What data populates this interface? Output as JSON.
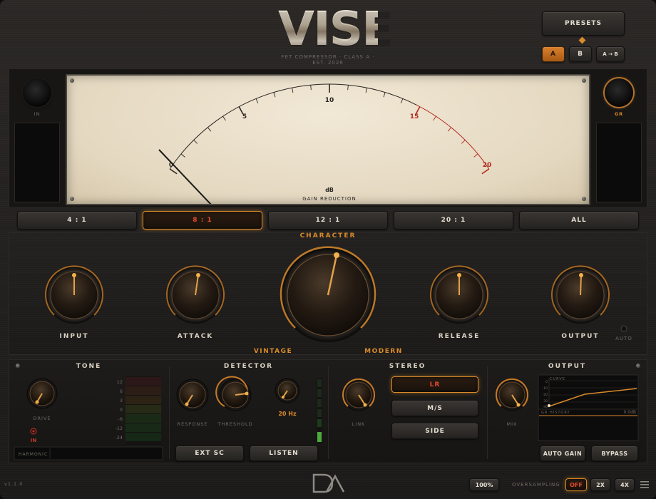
{
  "header": {
    "logo": "VISE",
    "subtitle": "FET COMPRESSOR  ·  CLASS A  ·  EST. 2026",
    "presets_label": "PRESETS",
    "ab_a": "A",
    "ab_b": "B",
    "ab_copy": "A → B"
  },
  "meter": {
    "in_label": "IN",
    "gr_label": "GR",
    "scale_labels": [
      "0",
      "5",
      "10",
      "15",
      "20"
    ],
    "unit": "dB",
    "caption": "GAIN REDUCTION",
    "needle_value_db": 0
  },
  "ratios": [
    "4 : 1",
    "8 : 1",
    "12 : 1",
    "20 : 1",
    "ALL"
  ],
  "ratio_selected": "8 : 1",
  "knobs": {
    "character_label": "CHARACTER",
    "input": "INPUT",
    "attack": "ATTACK",
    "release": "RELEASE",
    "output": "OUTPUT",
    "vintage": "VINTAGE",
    "modern": "MODERN",
    "auto": "AUTO"
  },
  "tone": {
    "title": "TONE",
    "drive_label": "DRIVE",
    "in_label": "IN",
    "harmonic_label": "HARMONIC",
    "scale": [
      "12",
      "6",
      "3",
      "0",
      "-6",
      "-12",
      "-24"
    ]
  },
  "detector": {
    "title": "DETECTOR",
    "response_label": "RESPONSE",
    "threshold_label": "THRESHOLD",
    "hpf_value": "20 Hz",
    "ext_sc": "EXT SC",
    "listen": "LISTEN"
  },
  "stereo": {
    "title": "STEREO",
    "link_label": "LINK",
    "modes": [
      "LR",
      "M/S",
      "SIDE"
    ],
    "mode_selected": "LR"
  },
  "output_section": {
    "title": "OUTPUT",
    "mix_label": "MIX",
    "curve_label": "CURVE",
    "curve_ticks": [
      "0",
      "-10",
      "-20",
      "-30",
      "-40"
    ],
    "gr_history_label": "GR HISTORY",
    "gr_history_value": "0.0dB",
    "auto_gain": "AUTO GAIN",
    "bypass": "BYPASS"
  },
  "footer": {
    "version": "v1.1.0",
    "zoom": "100%",
    "oversampling_label": "OVERSAMPLING",
    "os_options": [
      "OFF",
      "2X",
      "4X"
    ],
    "os_selected": "OFF"
  },
  "colors": {
    "accent": "#d98a2a",
    "red": "#c0382a",
    "meter_face": "#ece2cd"
  }
}
